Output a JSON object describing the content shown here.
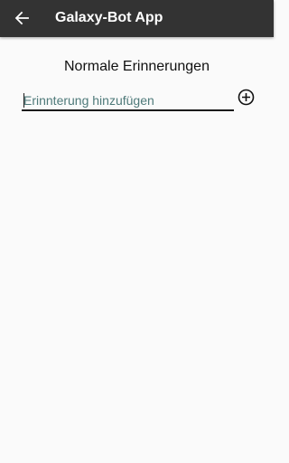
{
  "app_bar": {
    "title": "Galaxy-Bot App",
    "back_icon": "arrow-left-icon",
    "background": "#333333"
  },
  "main": {
    "section_title": "Normale Erinnerungen",
    "reminder_input": {
      "value": "",
      "placeholder": "Erinnterung hinzufügen"
    },
    "add_icon": "plus-circle-icon"
  }
}
